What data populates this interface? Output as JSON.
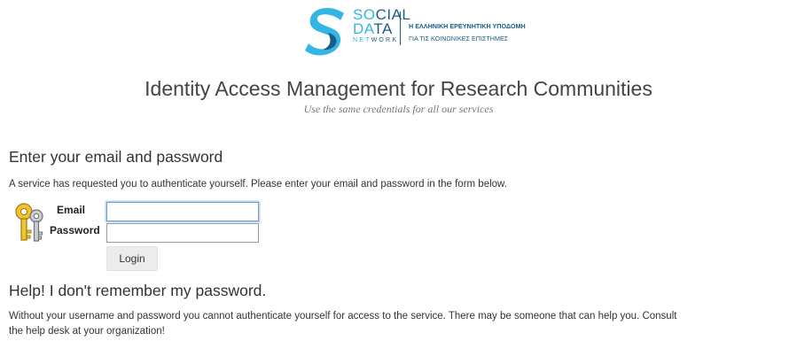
{
  "header": {
    "logo": {
      "line1_hl": "SO",
      "line1_rest": "CIAL",
      "line2_hl": "DA",
      "line2_rest": "TA",
      "line3_hl": "NET",
      "line3_rest": "WORK",
      "greek_line1": "Η ΕΛΛΗΝΙΚΗ ΕΡΕΥΝΗΤΙΚΗ ΥΠΟΔΟΜΗ",
      "greek_line2": "ΓΙΑ ΤΙΣ ΚΟΙΝΩΝΙΚΕΣ ΕΠΙΣΤΗΜΕΣ",
      "colors": {
        "dark": "#1a5d87",
        "light": "#34b6e4"
      }
    },
    "title": "Identity Access Management for Research Communities",
    "subtitle": "Use the same credentials for all our services"
  },
  "login": {
    "heading": "Enter your email and password",
    "description": "A service has requested you to authenticate yourself. Please enter your email and password in the form below.",
    "email_label": "Email",
    "email_value": "",
    "password_label": "Password",
    "password_value": "",
    "button_label": "Login",
    "icon": "keys-icon"
  },
  "help": {
    "heading": "Help! I don't remember my password.",
    "text_line1": "Without your username and password you cannot authenticate yourself for access to the service. There may be someone that can help you. Consult",
    "text_line2": "the help desk at your organization!"
  }
}
